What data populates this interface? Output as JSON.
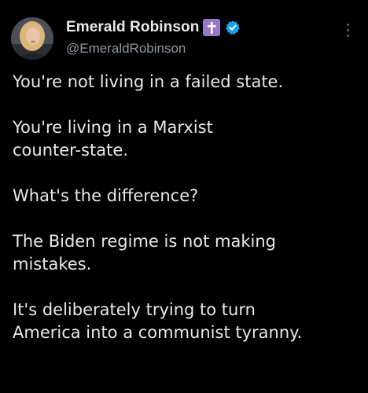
{
  "author": {
    "display_name": "Emerald Robinson",
    "handle": "@EmeraldRobinson",
    "badges": [
      "latin-cross-icon",
      "verified-icon"
    ]
  },
  "tweet": {
    "paragraphs": [
      "You're not living in a failed state.",
      "You're living in a Marxist\ncounter-state.",
      "What's the difference?",
      "The Biden regime is not making\nmistakes.",
      "It's deliberately trying to turn\nAmerica into a communist tyranny."
    ]
  },
  "colors": {
    "background": "#000000",
    "text": "#e7e9ea",
    "secondary_text": "#8b98a5",
    "verified_blue": "#1d9bf0",
    "cross_badge": "#9a78c8"
  }
}
